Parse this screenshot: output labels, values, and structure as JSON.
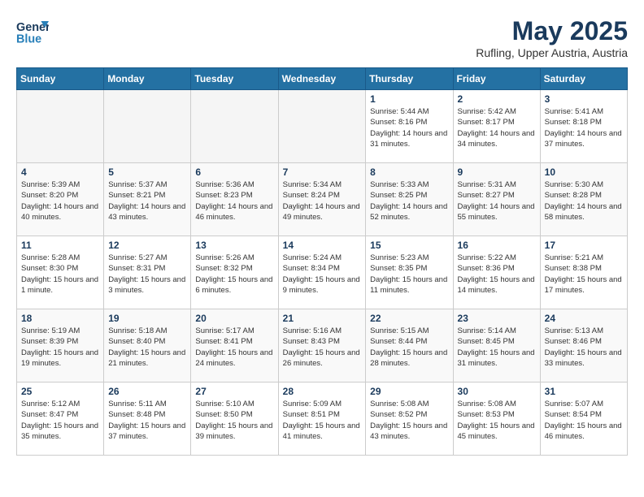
{
  "header": {
    "logo_line1": "General",
    "logo_line2": "Blue",
    "month": "May 2025",
    "location": "Rufling, Upper Austria, Austria"
  },
  "weekdays": [
    "Sunday",
    "Monday",
    "Tuesday",
    "Wednesday",
    "Thursday",
    "Friday",
    "Saturday"
  ],
  "weeks": [
    [
      {
        "day": "",
        "empty": true
      },
      {
        "day": "",
        "empty": true
      },
      {
        "day": "",
        "empty": true
      },
      {
        "day": "",
        "empty": true
      },
      {
        "day": "1",
        "sunrise": "5:44 AM",
        "sunset": "8:16 PM",
        "daylight": "14 hours and 31 minutes."
      },
      {
        "day": "2",
        "sunrise": "5:42 AM",
        "sunset": "8:17 PM",
        "daylight": "14 hours and 34 minutes."
      },
      {
        "day": "3",
        "sunrise": "5:41 AM",
        "sunset": "8:18 PM",
        "daylight": "14 hours and 37 minutes."
      }
    ],
    [
      {
        "day": "4",
        "sunrise": "5:39 AM",
        "sunset": "8:20 PM",
        "daylight": "14 hours and 40 minutes."
      },
      {
        "day": "5",
        "sunrise": "5:37 AM",
        "sunset": "8:21 PM",
        "daylight": "14 hours and 43 minutes."
      },
      {
        "day": "6",
        "sunrise": "5:36 AM",
        "sunset": "8:23 PM",
        "daylight": "14 hours and 46 minutes."
      },
      {
        "day": "7",
        "sunrise": "5:34 AM",
        "sunset": "8:24 PM",
        "daylight": "14 hours and 49 minutes."
      },
      {
        "day": "8",
        "sunrise": "5:33 AM",
        "sunset": "8:25 PM",
        "daylight": "14 hours and 52 minutes."
      },
      {
        "day": "9",
        "sunrise": "5:31 AM",
        "sunset": "8:27 PM",
        "daylight": "14 hours and 55 minutes."
      },
      {
        "day": "10",
        "sunrise": "5:30 AM",
        "sunset": "8:28 PM",
        "daylight": "14 hours and 58 minutes."
      }
    ],
    [
      {
        "day": "11",
        "sunrise": "5:28 AM",
        "sunset": "8:30 PM",
        "daylight": "15 hours and 1 minute."
      },
      {
        "day": "12",
        "sunrise": "5:27 AM",
        "sunset": "8:31 PM",
        "daylight": "15 hours and 3 minutes."
      },
      {
        "day": "13",
        "sunrise": "5:26 AM",
        "sunset": "8:32 PM",
        "daylight": "15 hours and 6 minutes."
      },
      {
        "day": "14",
        "sunrise": "5:24 AM",
        "sunset": "8:34 PM",
        "daylight": "15 hours and 9 minutes."
      },
      {
        "day": "15",
        "sunrise": "5:23 AM",
        "sunset": "8:35 PM",
        "daylight": "15 hours and 11 minutes."
      },
      {
        "day": "16",
        "sunrise": "5:22 AM",
        "sunset": "8:36 PM",
        "daylight": "15 hours and 14 minutes."
      },
      {
        "day": "17",
        "sunrise": "5:21 AM",
        "sunset": "8:38 PM",
        "daylight": "15 hours and 17 minutes."
      }
    ],
    [
      {
        "day": "18",
        "sunrise": "5:19 AM",
        "sunset": "8:39 PM",
        "daylight": "15 hours and 19 minutes."
      },
      {
        "day": "19",
        "sunrise": "5:18 AM",
        "sunset": "8:40 PM",
        "daylight": "15 hours and 21 minutes."
      },
      {
        "day": "20",
        "sunrise": "5:17 AM",
        "sunset": "8:41 PM",
        "daylight": "15 hours and 24 minutes."
      },
      {
        "day": "21",
        "sunrise": "5:16 AM",
        "sunset": "8:43 PM",
        "daylight": "15 hours and 26 minutes."
      },
      {
        "day": "22",
        "sunrise": "5:15 AM",
        "sunset": "8:44 PM",
        "daylight": "15 hours and 28 minutes."
      },
      {
        "day": "23",
        "sunrise": "5:14 AM",
        "sunset": "8:45 PM",
        "daylight": "15 hours and 31 minutes."
      },
      {
        "day": "24",
        "sunrise": "5:13 AM",
        "sunset": "8:46 PM",
        "daylight": "15 hours and 33 minutes."
      }
    ],
    [
      {
        "day": "25",
        "sunrise": "5:12 AM",
        "sunset": "8:47 PM",
        "daylight": "15 hours and 35 minutes."
      },
      {
        "day": "26",
        "sunrise": "5:11 AM",
        "sunset": "8:48 PM",
        "daylight": "15 hours and 37 minutes."
      },
      {
        "day": "27",
        "sunrise": "5:10 AM",
        "sunset": "8:50 PM",
        "daylight": "15 hours and 39 minutes."
      },
      {
        "day": "28",
        "sunrise": "5:09 AM",
        "sunset": "8:51 PM",
        "daylight": "15 hours and 41 minutes."
      },
      {
        "day": "29",
        "sunrise": "5:08 AM",
        "sunset": "8:52 PM",
        "daylight": "15 hours and 43 minutes."
      },
      {
        "day": "30",
        "sunrise": "5:08 AM",
        "sunset": "8:53 PM",
        "daylight": "15 hours and 45 minutes."
      },
      {
        "day": "31",
        "sunrise": "5:07 AM",
        "sunset": "8:54 PM",
        "daylight": "15 hours and 46 minutes."
      }
    ]
  ],
  "labels": {
    "sunrise_prefix": "Sunrise: ",
    "sunset_prefix": "Sunset: ",
    "daylight_prefix": "Daylight: "
  }
}
